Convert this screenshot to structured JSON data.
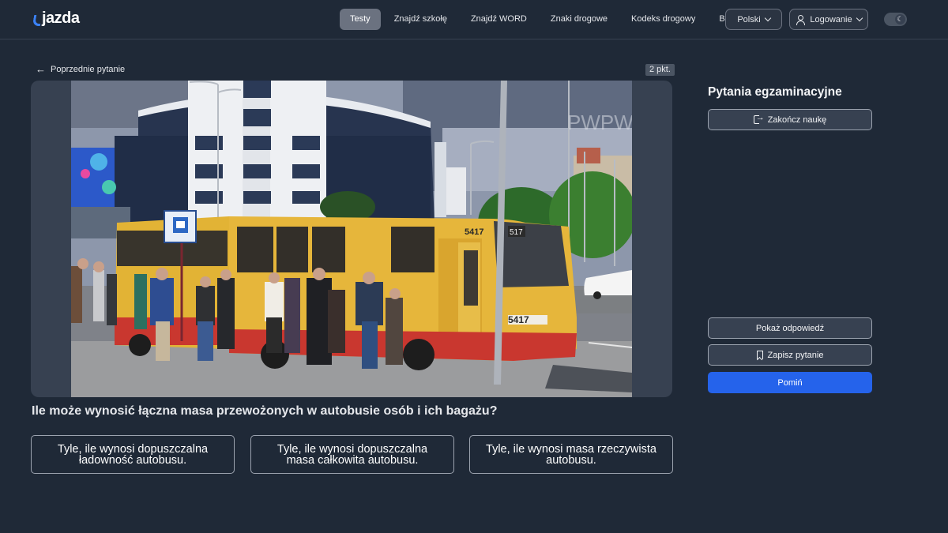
{
  "header": {
    "logo": "jazda",
    "nav": [
      "Testy",
      "Znajdź szkołę",
      "Znajdź WORD",
      "Znaki drogowe",
      "Kodeks drogowy",
      "Blog"
    ],
    "active_nav": "Testy",
    "language": "Polski",
    "login": "Logowanie",
    "theme_icon": "moon-icon"
  },
  "question_nav": {
    "back_label": "Poprzednie pytanie",
    "points": "2 pkt."
  },
  "media": {
    "watermark": "PWPW",
    "bus_number": "5417",
    "route_number": "517"
  },
  "question": {
    "text": "Ile może wynosić łączna masa przewożonych w autobusie osób i ich bagażu?",
    "answers": [
      "Tyle, ile wynosi dopuszczalna ładowność autobusu.",
      "Tyle, ile wynosi dopuszczalna masa całkowita autobusu.",
      "Tyle, ile wynosi masa rzeczywista autobusu."
    ]
  },
  "panel": {
    "title": "Pytania egzaminacyjne",
    "end_label": "Zakończ naukę",
    "show_answer_label": "Pokaż odpowiedź",
    "save_label": "Zapisz pytanie",
    "skip_label": "Pomiń"
  },
  "colors": {
    "background": "#1f2937",
    "accent": "#2563eb",
    "active_nav": "#6b7280"
  }
}
